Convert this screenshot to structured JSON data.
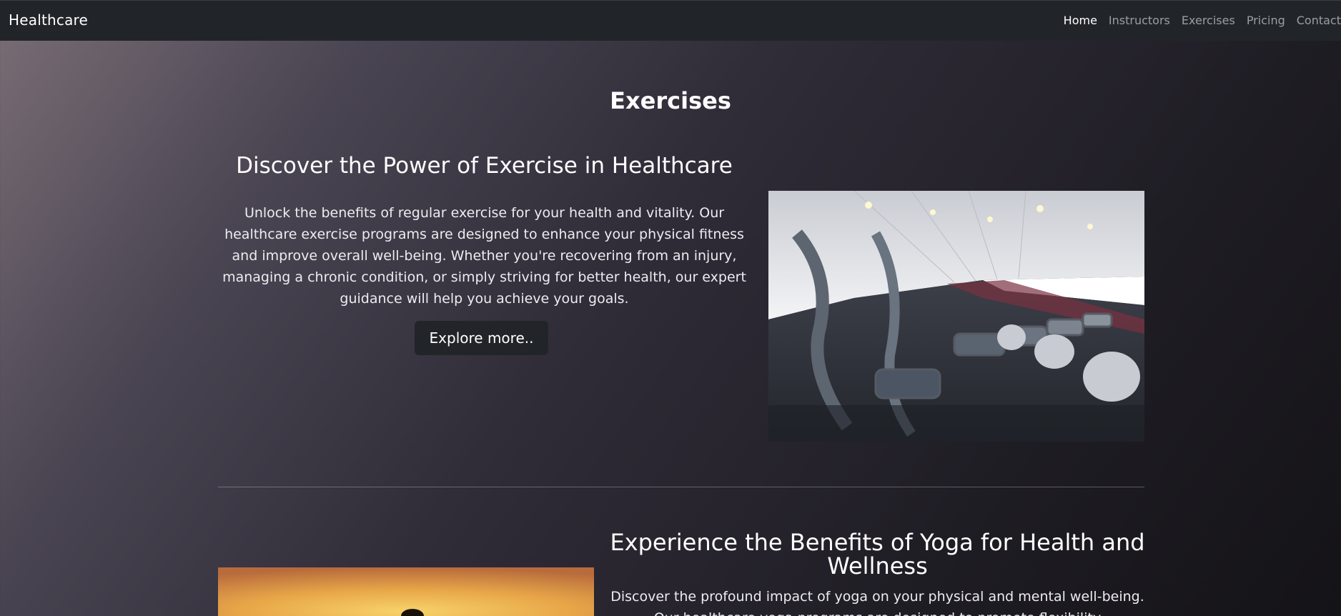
{
  "navbar": {
    "brand": "Healthcare",
    "links": [
      {
        "label": "Home",
        "active": true
      },
      {
        "label": "Instructors",
        "active": false
      },
      {
        "label": "Exercises",
        "active": false
      },
      {
        "label": "Pricing",
        "active": false
      },
      {
        "label": "Contact",
        "active": false
      }
    ]
  },
  "page": {
    "title": "Exercises"
  },
  "section1": {
    "heading": "Discover the Power of Exercise in Healthcare",
    "text": "Unlock the benefits of regular exercise for your health and vitality. Our healthcare exercise programs are designed to enhance your physical fitness and improve overall well-being. Whether you're recovering from an injury, managing a chronic condition, or simply striving for better health, our expert guidance will help you achieve your goals.",
    "button_label": "Explore more.."
  },
  "section2": {
    "heading": "Experience the Benefits of Yoga for Health and Wellness",
    "text": "Discover the profound impact of yoga on your physical and mental well-being. Our healthcare yoga programs are designed to promote flexibility"
  },
  "colors": {
    "navbar_bg": "#212529",
    "button_bg": "#212529",
    "text": "#ffffff"
  }
}
